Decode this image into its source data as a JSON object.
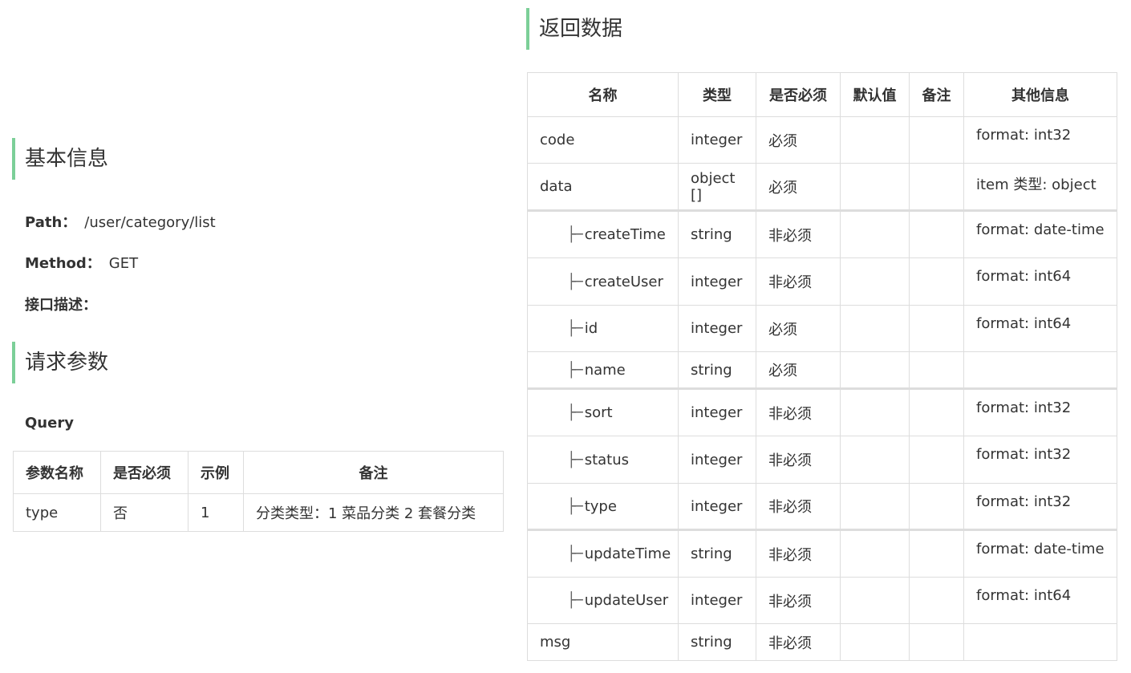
{
  "basic_info": {
    "heading": "基本信息",
    "path_label": "Path：",
    "path_value": "/user/category/list",
    "method_label": "Method：",
    "method_value": "GET",
    "desc_label": "接口描述："
  },
  "request": {
    "heading": "请求参数",
    "query_label": "Query",
    "headers": [
      "参数名称",
      "是否必须",
      "示例",
      "备注"
    ],
    "rows": [
      {
        "name": "type",
        "required": "否",
        "example": "1",
        "note": "分类类型：1 菜品分类 2 套餐分类"
      }
    ]
  },
  "response": {
    "heading": "返回数据",
    "headers": [
      "名称",
      "类型",
      "是否必须",
      "默认值",
      "备注",
      "其他信息"
    ],
    "tree_glyph": "├─",
    "rows": [
      {
        "name": "code",
        "type": "integer",
        "required": "必须",
        "default": "",
        "note": "",
        "other": "format: int32",
        "child": false
      },
      {
        "name": "data",
        "type": "object []",
        "required": "必须",
        "default": "",
        "note": "",
        "other": "item 类型: object",
        "child": false
      },
      {
        "name": "createTime",
        "type": "string",
        "required": "非必须",
        "default": "",
        "note": "",
        "other": "format: date-time",
        "child": true
      },
      {
        "name": "createUser",
        "type": "integer",
        "required": "非必须",
        "default": "",
        "note": "",
        "other": "format: int64",
        "child": true
      },
      {
        "name": "id",
        "type": "integer",
        "required": "必须",
        "default": "",
        "note": "",
        "other": "format: int64",
        "child": true
      },
      {
        "name": "name",
        "type": "string",
        "required": "必须",
        "default": "",
        "note": "",
        "other": "",
        "child": true
      },
      {
        "name": "sort",
        "type": "integer",
        "required": "非必须",
        "default": "",
        "note": "",
        "other": "format: int32",
        "child": true
      },
      {
        "name": "status",
        "type": "integer",
        "required": "非必须",
        "default": "",
        "note": "",
        "other": "format: int32",
        "child": true
      },
      {
        "name": "type",
        "type": "integer",
        "required": "非必须",
        "default": "",
        "note": "",
        "other": "format: int32",
        "child": true
      },
      {
        "name": "updateTime",
        "type": "string",
        "required": "非必须",
        "default": "",
        "note": "",
        "other": "format: date-time",
        "child": true
      },
      {
        "name": "updateUser",
        "type": "integer",
        "required": "非必须",
        "default": "",
        "note": "",
        "other": "format: int64",
        "child": true
      },
      {
        "name": "msg",
        "type": "string",
        "required": "非必须",
        "default": "",
        "note": "",
        "other": "",
        "child": false
      }
    ]
  },
  "colors": {
    "accent": "#7ccf98",
    "border": "#dddddd",
    "text": "#333333"
  }
}
